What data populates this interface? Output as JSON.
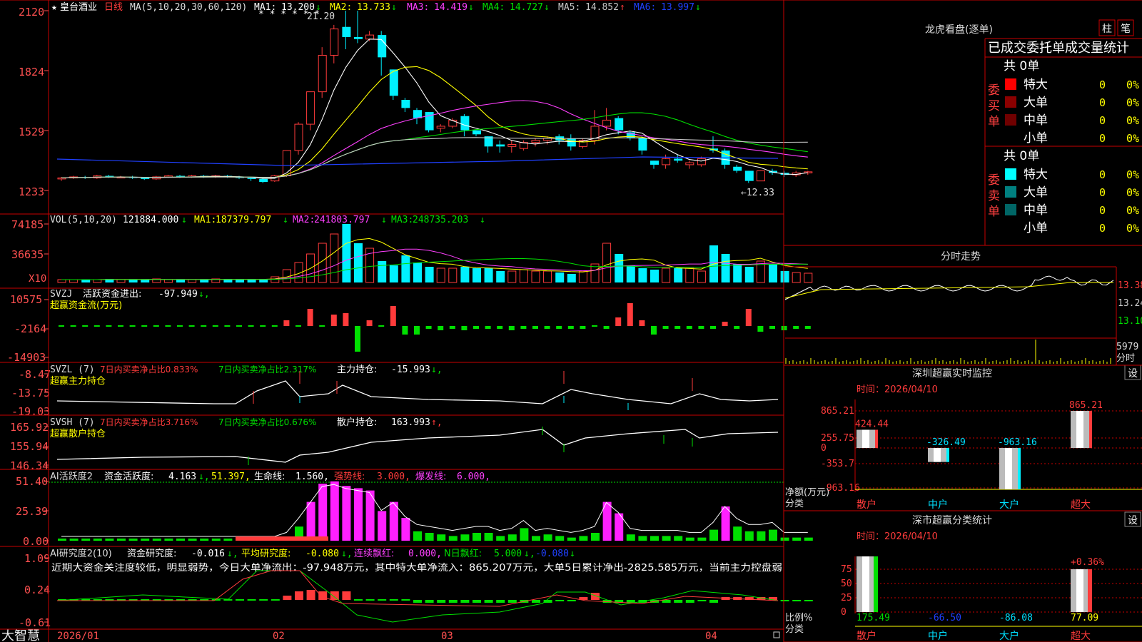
{
  "colors": {
    "up": "#ff3b3b",
    "down": "#00f0ff",
    "ma1": "#ffffff",
    "ma2": "#ffff00",
    "ma3": "#ff40ff",
    "ma4": "#00e000",
    "ma5": "#c8c8c8",
    "ma6": "#2040ff",
    "pink": "#ff20ff",
    "green": "#00e000",
    "grid": "#a00000",
    "axis": "#ff5050"
  },
  "main": {
    "title_star": "★",
    "stock_name": "皇台酒业",
    "period": "日线",
    "ma_header": "MA(5,10,20,30,60,120)",
    "ma": [
      {
        "label": "MA1:",
        "value": "13.200",
        "arrow": "↓"
      },
      {
        "label": "MA2:",
        "value": "13.733",
        "arrow": "↓"
      },
      {
        "label": "MA3:",
        "value": "14.419",
        "arrow": "↓"
      },
      {
        "label": "MA4:",
        "value": "14.727",
        "arrow": "↓"
      },
      {
        "label": "MA5:",
        "value": "14.852",
        "arrow": "↑"
      },
      {
        "label": "MA6:",
        "value": "13.997",
        "arrow": "↓"
      }
    ],
    "y_ticks": [
      "2120",
      "1824",
      "1529",
      "1233"
    ],
    "high_label": "21.20",
    "low_label": "←12.33",
    "stars": "* * * * * *"
  },
  "vol": {
    "header": "VOL(5,10,20)",
    "value": "121884.000",
    "arrow": "↓",
    "ma": [
      {
        "label": "MA1:",
        "value": "187379.797",
        "arrow": "↓"
      },
      {
        "label": "MA2:",
        "value": "241803.797",
        "arrow": "↓"
      },
      {
        "label": "MA3:",
        "value": "248735.203",
        "arrow": "↓"
      }
    ],
    "y_ticks": [
      "74185",
      "36635"
    ],
    "unit": "X10"
  },
  "svzj": {
    "header": "SVZJ",
    "label": "活跃资金进出:",
    "value": "-97.949",
    "arrow": "↓,",
    "sub": "超赢资金流(万元)",
    "y_ticks": [
      "10575",
      "-2164",
      "-14903"
    ]
  },
  "svzl": {
    "header": "SVZL (7)",
    "t1": "7日内买卖净占比0.833%",
    "t2": "7日内买卖净占比2.317%",
    "t3": "主力持仓:",
    "value": "-15.993",
    "arrow": "↓,",
    "sub": "超赢主力持仓",
    "y_ticks": [
      "-8.47",
      "-13.75",
      "-19.03"
    ]
  },
  "svsh": {
    "header": "SVSH (7)",
    "t1": "7日内买卖净占比3.716%",
    "t2": "7日内买卖净占比0.676%",
    "t3": "散户持仓:",
    "value": "163.993",
    "arrow": "↑,",
    "sub": "超赢散户持仓",
    "y_ticks": [
      "165.92",
      "155.94",
      "146.34"
    ]
  },
  "ai1": {
    "header": "AI活跃度2",
    "t1": "资金活跃度:",
    "v1": "4.163",
    "a1": "↓,",
    "v2": "51.397,",
    "t3": "生命线:",
    "v3": "1.560,",
    "t4": "强势线:",
    "v4": "3.000,",
    "t5": "爆发线:",
    "v5": "6.000,",
    "y_ticks": [
      "51.40",
      "25.39",
      "0.00"
    ]
  },
  "ai2": {
    "header": "AI研究度2(10)",
    "t1": "资金研究度:",
    "v1": "-0.016",
    "a1": "↓,",
    "t2": "平均研究度:",
    "v2": "-0.080",
    "a2": "↓,",
    "t3": "连续飘红:",
    "v3": "0.000,",
    "t4": "N日飘红:",
    "v4": "5.000",
    "a4": "↓,",
    "v5": "-0.080",
    "a5": "↓",
    "comment": "近期大资金关注度较低，明显弱势，今日大单净流出：-97.948万元，其中特大单净流入：865.207万元，大单5日累计净出-2825.585万元，当前主力控盘弱",
    "y_ticks": [
      "1.09",
      "0.24",
      "-0.61"
    ]
  },
  "xaxis": {
    "dates": [
      "2026/01",
      "02",
      "03",
      "04"
    ]
  },
  "brand": "大智慧",
  "right": {
    "longhu": {
      "title": "龙虎看盘(逐单)",
      "btn1": "柱",
      "btn2": "笔",
      "table_title": "已成交委托单成交量统计",
      "buy_label": "委买单",
      "sell_label": "委卖单",
      "total": "共 0单",
      "rows": [
        "特大",
        "大单",
        "中单",
        "小单"
      ],
      "zero": "0",
      "pct": "0%"
    },
    "fenshi": {
      "title": "分时走势",
      "p1": "13.38",
      "p2": "13.24",
      "p3": "13.10",
      "vol": "5979",
      "unit": "分时"
    },
    "sz": {
      "title": "深圳超赢实时监控",
      "btn": "设",
      "time": "时间：2026/04/10",
      "y_ticks": [
        "865.21",
        "255.75",
        "0",
        "-353.7",
        "-963.16"
      ],
      "ylabel": "净额(万元)",
      "xlabel": "分类",
      "cats": [
        "散户",
        "中户",
        "大户",
        "超大"
      ],
      "values": [
        "424.44",
        "-326.49",
        "-963.16",
        "865.21"
      ]
    },
    "ss": {
      "title": "深市超赢分类统计",
      "btn": "设",
      "time": "时间：2026/04/10",
      "y_ticks": [
        "75",
        "50",
        "25",
        "0"
      ],
      "ylabel": "比例%",
      "xlabel": "分类",
      "cats": [
        "散户",
        "中户",
        "大户",
        "超大"
      ],
      "values": [
        "175.49",
        "-66.50",
        "-86.08",
        "77.09"
      ],
      "top_label": "+0.36%"
    }
  },
  "chart_data": {
    "type": "candlestick",
    "candles": [
      [
        12.9,
        12.95,
        12.8,
        13.0
      ],
      [
        12.95,
        13.0,
        12.9,
        13.05
      ],
      [
        13.0,
        12.95,
        12.9,
        13.05
      ],
      [
        12.95,
        13.05,
        12.9,
        13.1
      ],
      [
        13.05,
        13.0,
        12.95,
        13.1
      ],
      [
        13.0,
        13.0,
        12.95,
        13.05
      ],
      [
        13.0,
        12.95,
        12.9,
        13.05
      ],
      [
        12.95,
        12.9,
        12.85,
        13.0
      ],
      [
        12.9,
        13.0,
        12.85,
        13.05
      ],
      [
        13.0,
        13.05,
        12.95,
        13.1
      ],
      [
        13.05,
        13.0,
        12.95,
        13.1
      ],
      [
        13.0,
        13.05,
        12.95,
        13.1
      ],
      [
        13.05,
        13.0,
        12.95,
        13.1
      ],
      [
        13.0,
        13.05,
        12.95,
        13.1
      ],
      [
        13.05,
        13.0,
        12.95,
        13.1
      ],
      [
        13.0,
        12.95,
        12.9,
        13.05
      ],
      [
        12.95,
        12.9,
        12.8,
        13.0
      ],
      [
        12.9,
        12.75,
        12.7,
        12.95
      ],
      [
        12.8,
        13.05,
        12.75,
        13.1
      ],
      [
        13.05,
        14.3,
        13.0,
        14.3
      ],
      [
        14.3,
        15.6,
        14.1,
        15.7
      ],
      [
        15.6,
        17.2,
        15.3,
        17.2
      ],
      [
        17.2,
        19.0,
        16.9,
        19.4
      ],
      [
        19.0,
        20.3,
        18.6,
        20.5
      ],
      [
        20.4,
        19.9,
        19.3,
        21.2
      ],
      [
        19.9,
        19.8,
        19.6,
        21.2
      ],
      [
        19.8,
        20.0,
        19.7,
        20.2
      ],
      [
        20.0,
        18.9,
        18.0,
        20.2
      ],
      [
        18.3,
        17.0,
        16.8,
        18.3
      ],
      [
        16.8,
        16.4,
        16.2,
        16.9
      ],
      [
        16.3,
        15.9,
        15.6,
        16.4
      ],
      [
        16.2,
        15.3,
        15.2,
        16.2
      ],
      [
        15.4,
        15.5,
        15.2,
        15.6
      ],
      [
        15.5,
        15.8,
        15.4,
        15.9
      ],
      [
        16.0,
        15.3,
        15.0,
        16.1
      ],
      [
        15.3,
        15.1,
        15.0,
        15.3
      ],
      [
        15.0,
        14.5,
        14.2,
        15.0
      ],
      [
        14.6,
        14.5,
        14.2,
        14.8
      ],
      [
        14.5,
        14.6,
        14.2,
        14.8
      ],
      [
        14.4,
        14.7,
        14.3,
        14.8
      ],
      [
        14.7,
        14.8,
        14.5,
        14.9
      ],
      [
        14.8,
        14.9,
        14.6,
        15.0
      ],
      [
        15.0,
        14.8,
        14.6,
        15.1
      ],
      [
        14.9,
        14.5,
        14.3,
        15.1
      ],
      [
        14.5,
        14.8,
        14.4,
        14.9
      ],
      [
        14.8,
        15.5,
        14.6,
        16.3
      ],
      [
        15.5,
        15.8,
        15.3,
        16.4
      ],
      [
        15.9,
        15.3,
        15.1,
        16.0
      ],
      [
        15.2,
        14.9,
        14.8,
        15.3
      ],
      [
        14.9,
        14.3,
        14.1,
        15.0
      ],
      [
        13.8,
        13.6,
        13.4,
        13.8
      ],
      [
        13.6,
        13.9,
        13.4,
        14.1
      ],
      [
        13.9,
        13.8,
        13.7,
        14.1
      ],
      [
        13.6,
        13.7,
        13.4,
        13.8
      ],
      [
        13.6,
        13.9,
        13.5,
        14.0
      ],
      [
        14.4,
        14.3,
        14.2,
        15.0
      ],
      [
        14.3,
        13.6,
        13.4,
        14.4
      ],
      [
        13.5,
        13.3,
        13.2,
        13.6
      ],
      [
        13.3,
        12.8,
        12.7,
        13.3
      ],
      [
        12.8,
        13.3,
        12.8,
        13.3
      ],
      [
        13.3,
        13.2,
        13.1,
        13.4
      ],
      [
        13.2,
        13.1,
        13.0,
        13.3
      ],
      [
        13.1,
        13.2,
        13.0,
        13.3
      ],
      [
        13.2,
        13.25,
        13.1,
        13.3
      ]
    ]
  }
}
